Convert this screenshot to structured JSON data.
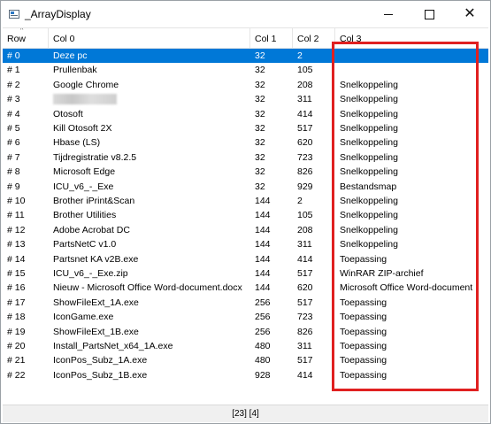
{
  "window": {
    "title": "_ArrayDisplay"
  },
  "columns": [
    "Row",
    "Col 0",
    "Col 1",
    "Col 2",
    "Col 3"
  ],
  "rows": [
    {
      "row": "# 0",
      "c0": "Deze pc",
      "c1": "32",
      "c2": "2",
      "c3": "",
      "selected": true
    },
    {
      "row": "# 1",
      "c0": "Prullenbak",
      "c1": "32",
      "c2": "105",
      "c3": ""
    },
    {
      "row": "# 2",
      "c0": "Google Chrome",
      "c1": "32",
      "c2": "208",
      "c3": "Snelkoppeling"
    },
    {
      "row": "# 3",
      "c0": "",
      "c1": "32",
      "c2": "311",
      "c3": "Snelkoppeling",
      "blurred": true
    },
    {
      "row": "# 4",
      "c0": "Otosoft",
      "c1": "32",
      "c2": "414",
      "c3": "Snelkoppeling"
    },
    {
      "row": "# 5",
      "c0": "Kill Otosoft 2X",
      "c1": "32",
      "c2": "517",
      "c3": "Snelkoppeling"
    },
    {
      "row": "# 6",
      "c0": "Hbase (LS)",
      "c1": "32",
      "c2": "620",
      "c3": "Snelkoppeling"
    },
    {
      "row": "# 7",
      "c0": "Tijdregistratie v8.2.5",
      "c1": "32",
      "c2": "723",
      "c3": "Snelkoppeling"
    },
    {
      "row": "# 8",
      "c0": "Microsoft Edge",
      "c1": "32",
      "c2": "826",
      "c3": "Snelkoppeling"
    },
    {
      "row": "# 9",
      "c0": "ICU_v6_-_Exe",
      "c1": "32",
      "c2": "929",
      "c3": "Bestandsmap"
    },
    {
      "row": "# 10",
      "c0": "Brother iPrint&Scan",
      "c1": "144",
      "c2": "2",
      "c3": "Snelkoppeling"
    },
    {
      "row": "# 11",
      "c0": "Brother Utilities",
      "c1": "144",
      "c2": "105",
      "c3": "Snelkoppeling"
    },
    {
      "row": "# 12",
      "c0": "Adobe Acrobat DC",
      "c1": "144",
      "c2": "208",
      "c3": "Snelkoppeling"
    },
    {
      "row": "# 13",
      "c0": "PartsNetC v1.0",
      "c1": "144",
      "c2": "311",
      "c3": "Snelkoppeling"
    },
    {
      "row": "# 14",
      "c0": "Partsnet KA v2B.exe",
      "c1": "144",
      "c2": "414",
      "c3": "Toepassing"
    },
    {
      "row": "# 15",
      "c0": "ICU_v6_-_Exe.zip",
      "c1": "144",
      "c2": "517",
      "c3": "WinRAR ZIP-archief"
    },
    {
      "row": "# 16",
      "c0": "Nieuw - Microsoft Office Word-document.docx",
      "c1": "144",
      "c2": "620",
      "c3": "Microsoft Office Word-document"
    },
    {
      "row": "# 17",
      "c0": "ShowFileExt_1A.exe",
      "c1": "256",
      "c2": "517",
      "c3": "Toepassing"
    },
    {
      "row": "# 18",
      "c0": "IconGame.exe",
      "c1": "256",
      "c2": "723",
      "c3": "Toepassing"
    },
    {
      "row": "# 19",
      "c0": "ShowFileExt_1B.exe",
      "c1": "256",
      "c2": "826",
      "c3": "Toepassing"
    },
    {
      "row": "# 20",
      "c0": "Install_PartsNet_x64_1A.exe",
      "c1": "480",
      "c2": "311",
      "c3": "Toepassing"
    },
    {
      "row": "# 21",
      "c0": "IconPos_Subz_1A.exe",
      "c1": "480",
      "c2": "517",
      "c3": "Toepassing"
    },
    {
      "row": "# 22",
      "c0": "IconPos_Subz_1B.exe",
      "c1": "928",
      "c2": "414",
      "c3": "Toepassing"
    }
  ],
  "status": {
    "text": "[23] [4]"
  },
  "colors": {
    "selection": "#0078d7",
    "highlight_border": "#e02020"
  }
}
